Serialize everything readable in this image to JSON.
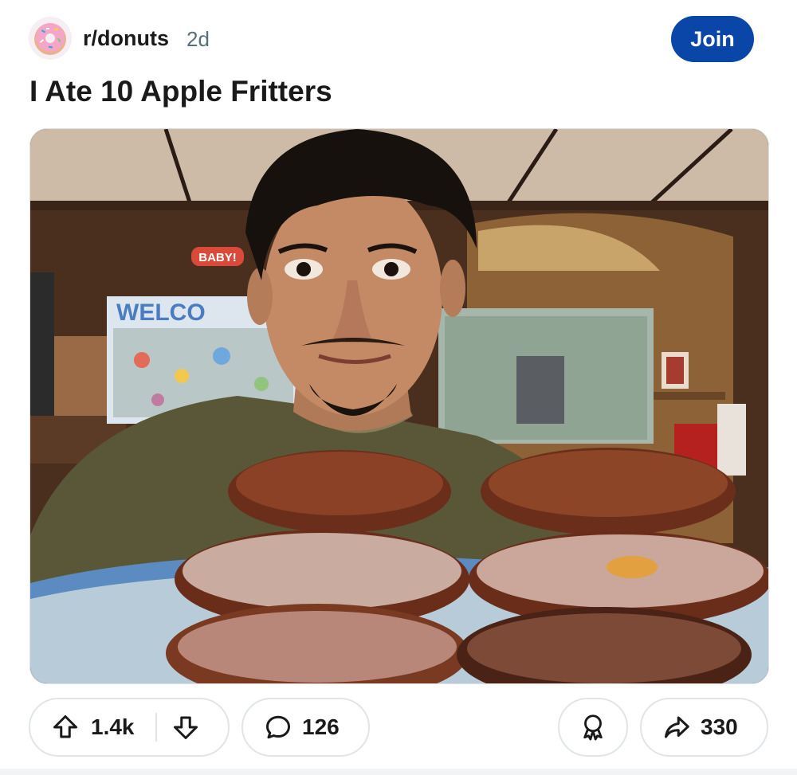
{
  "post": {
    "subreddit": "r/donuts",
    "age": "2d",
    "join_label": "Join",
    "title": "I Ate 10 Apple Fritters"
  },
  "image": {
    "description_icon": "photo",
    "sign_text": "BABY!",
    "poster_text": "WELCO"
  },
  "actions": {
    "upvote_icon": "arrow-up-icon",
    "vote_count": "1.4k",
    "downvote_icon": "arrow-down-icon",
    "comment_icon": "speech-bubble-icon",
    "comment_count": "126",
    "award_icon": "award-icon",
    "share_icon": "share-arrow-icon",
    "share_count": "330"
  },
  "colors": {
    "join_button": "#0a45a8",
    "meta_text": "#576f76",
    "pill_border": "#e1e5e8"
  }
}
